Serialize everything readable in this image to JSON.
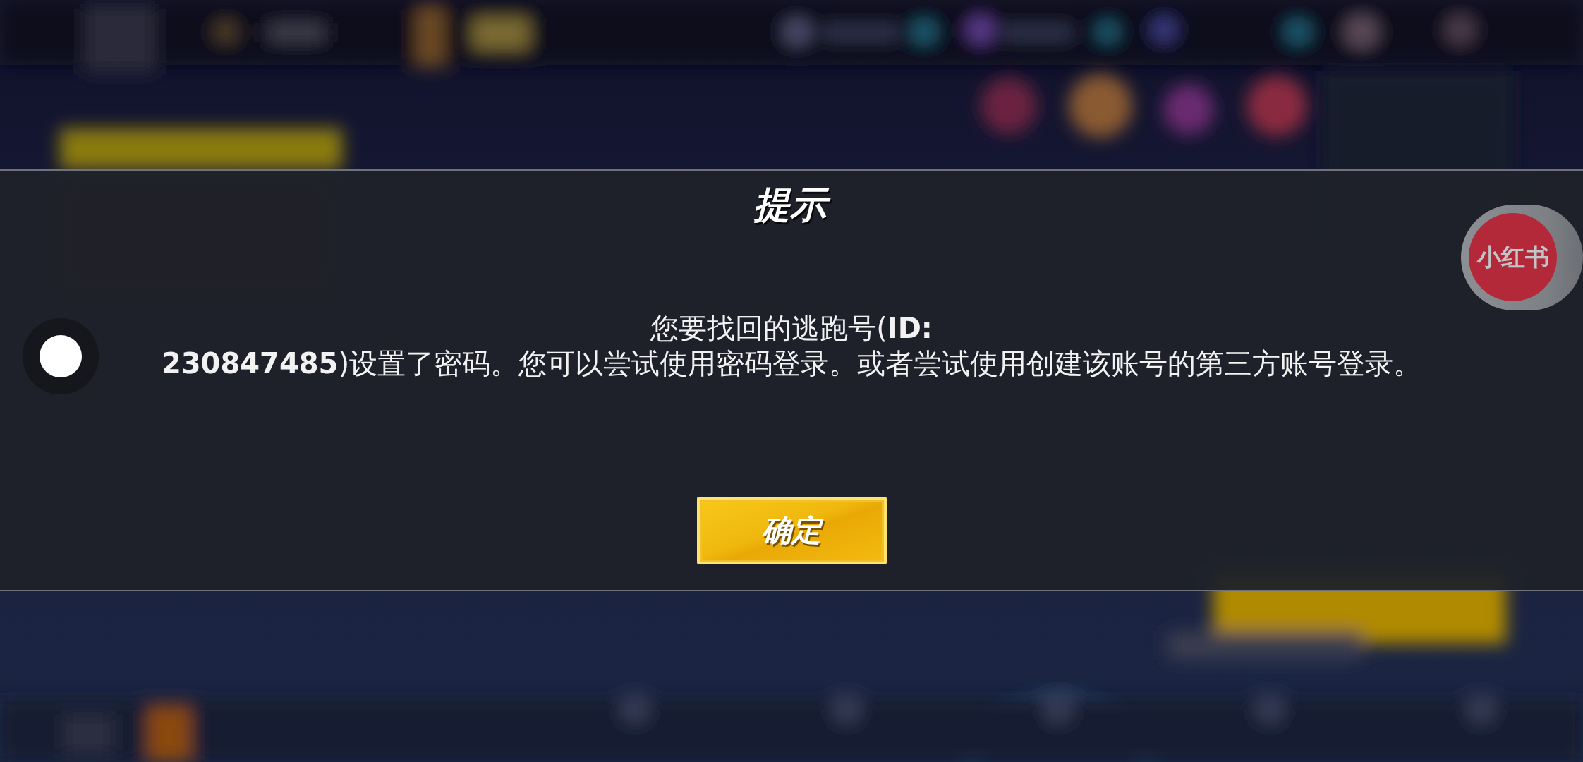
{
  "dialog": {
    "title": "提示",
    "message": "您要找回的逃跑号(**ID:**\n**230847485**)设置了密码。您可以尝试使用密码登录。或者尝试使用创建该账号的第三方账号登录。",
    "button": "确定"
  },
  "floating_app": {
    "label": "小红书"
  }
}
